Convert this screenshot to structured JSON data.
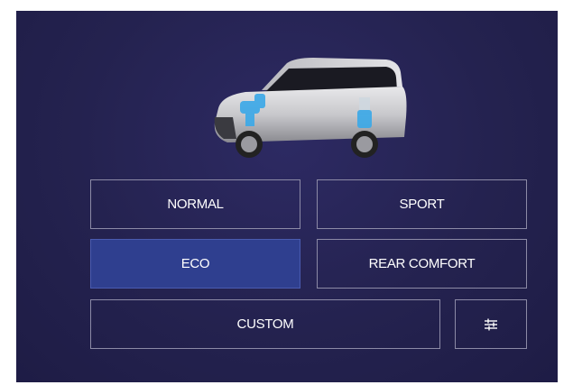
{
  "modes": {
    "normal": "NORMAL",
    "sport": "SPORT",
    "eco": "ECO",
    "rear_comfort": "REAR COMFORT",
    "custom": "CUSTOM"
  },
  "selected_mode": "ECO",
  "settings_icon": "sliders-icon",
  "colors": {
    "background": "#24224f",
    "active": "#2f3f8f",
    "border": "#8c8aa6",
    "suspension_highlight": "#3aa8e8"
  }
}
